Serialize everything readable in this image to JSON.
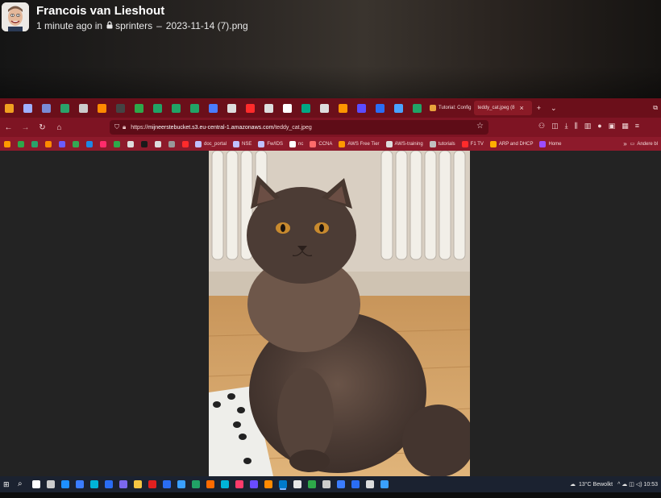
{
  "post": {
    "author": "Francois van Lieshout",
    "time_ago": "1 minute ago in",
    "channel": "sprinters",
    "separator": "–",
    "filename": "2023-11-14 (7).png"
  },
  "browser": {
    "tabs": [
      {
        "label": "Tutorial: Config",
        "color": "#e8a33c",
        "active": false
      },
      {
        "label": "teddy_cat.jpeg (8",
        "color": "#cccccc",
        "active": true
      }
    ],
    "tab_favicon_colors": [
      "#f0a020",
      "#9fb0ff",
      "#7a8bd6",
      "#2aa36a",
      "#cccccc",
      "#ff8a00",
      "#444444",
      "#2ea84a",
      "#21a366",
      "#21a366",
      "#21a366",
      "#4a7cff",
      "#dddddd",
      "#ff2b2b",
      "#dddddd",
      "#ffffff",
      "#00a884",
      "#dddddd",
      "#ff9500",
      "#5b4cff",
      "#2a6df4",
      "#4aa3ff",
      "#21a366"
    ],
    "close_glyph": "×",
    "new_tab_glyph": "+",
    "url_prefix": "https://",
    "url_host": "mijneerstebucket.s3.eu-central-1.amazonaws.com",
    "url_path": "/teddy_cat.jpeg",
    "bookmarks": [
      {
        "label": "doc_portal",
        "color": "#c0c0ff"
      },
      {
        "label": "NSE",
        "color": "#c0c0ff"
      },
      {
        "label": "Fw/IDS",
        "color": "#c0c0ff"
      },
      {
        "label": "nc",
        "color": "#ffffff"
      },
      {
        "label": "CCNA",
        "color": "#ff6b6b"
      },
      {
        "label": "AWS Free Tier",
        "color": "#ff9900"
      },
      {
        "label": "AWS-training",
        "color": "#dddddd"
      },
      {
        "label": "tutorials",
        "color": "#c0c0c0"
      },
      {
        "label": "F1 TV",
        "color": "#ff2b2b"
      },
      {
        "label": "ARP and DHCP",
        "color": "#ffb000"
      },
      {
        "label": "Home",
        "color": "#9d4cff"
      }
    ],
    "bookmark_icon_colors": [
      "#ff9900",
      "#2ea84a",
      "#2aa36a",
      "#ff8a00",
      "#6b5cff",
      "#34a853",
      "#1e88e5",
      "#ff2b6b",
      "#2ea84a",
      "#dddddd",
      "#1a1a1a",
      "#dddddd",
      "#999999",
      "#ff2b2b"
    ],
    "bookmarks_more": "»",
    "other_bookmarks": "Andere bl"
  },
  "taskbar": {
    "app_colors": [
      "#ffffff",
      "#cccccc",
      "#1e90ff",
      "#3b7dff",
      "#00b4d8",
      "#2a6df4",
      "#7b68ee",
      "#f5c542",
      "#e02020",
      "#2a6df4",
      "#3aa0ff",
      "#21a366",
      "#ff6b00",
      "#00b4d8",
      "#ff3b6b",
      "#6a4cff",
      "#ff8a00",
      "#007acc",
      "#e6e6e6",
      "#2ea84a",
      "#cccccc",
      "#3b7dff",
      "#2a6df4",
      "#dddddd",
      "#3aa0ff"
    ],
    "weather": "13°C  Bewolkt",
    "tray": "^ ☁ ◫ ◁)  10:53"
  }
}
